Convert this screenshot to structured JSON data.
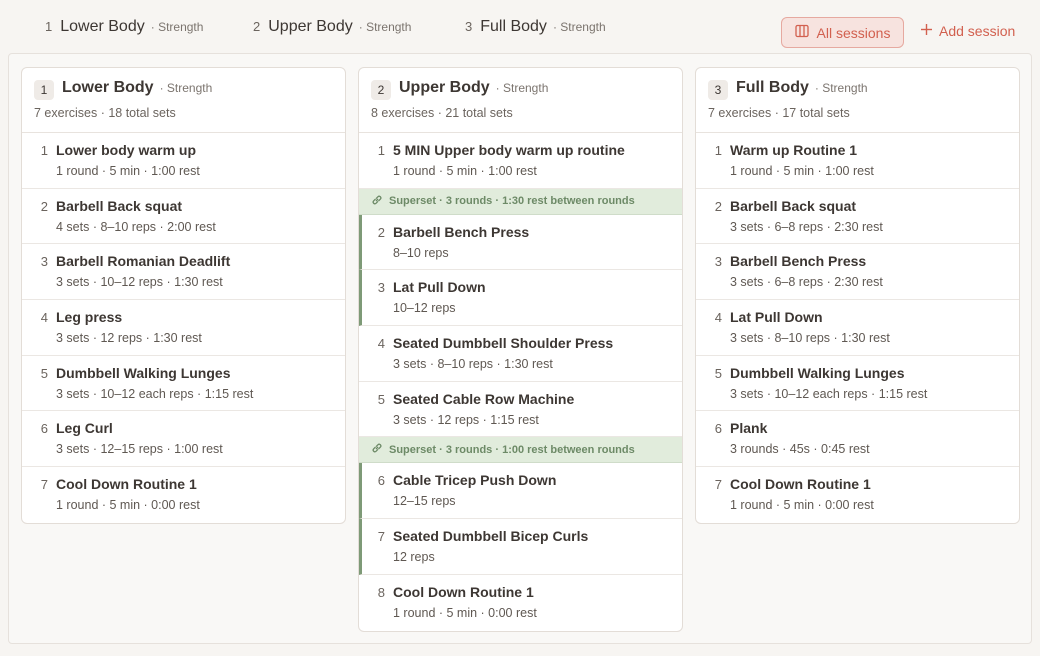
{
  "tabs": [
    {
      "num": "1",
      "name": "Lower Body",
      "type": "· Strength"
    },
    {
      "num": "2",
      "name": "Upper Body",
      "type": "· Strength"
    },
    {
      "num": "3",
      "name": "Full Body",
      "type": "· Strength"
    }
  ],
  "toolbar": {
    "all_sessions_label": "All sessions",
    "add_session_label": "Add session"
  },
  "columns": [
    {
      "num": "1",
      "title": "Lower Body",
      "type": "· Strength",
      "stats": "7 exercises · 18 total sets",
      "exercises": [
        {
          "num": "1",
          "name": "Lower body warm up",
          "detail": "1 round · 5 min · 1:00 rest"
        },
        {
          "num": "2",
          "name": "Barbell Back squat",
          "detail": "4 sets · 8–10 reps · 2:00 rest"
        },
        {
          "num": "3",
          "name": "Barbell Romanian Deadlift",
          "detail": "3 sets · 10–12 reps · 1:30 rest"
        },
        {
          "num": "4",
          "name": "Leg press",
          "detail": "3 sets · 12 reps · 1:30 rest"
        },
        {
          "num": "5",
          "name": "Dumbbell Walking Lunges",
          "detail": "3 sets · 10–12 each reps · 1:15 rest"
        },
        {
          "num": "6",
          "name": "Leg Curl",
          "detail": "3 sets · 12–15 reps · 1:00 rest"
        },
        {
          "num": "7",
          "name": "Cool Down Routine 1",
          "detail": "1 round · 5 min · 0:00 rest"
        }
      ]
    },
    {
      "num": "2",
      "title": "Upper Body",
      "type": "· Strength",
      "stats": "8 exercises · 21 total sets",
      "exercises": [
        {
          "num": "1",
          "name": "5 MIN Upper body warm up routine",
          "detail": "1 round · 5 min · 1:00 rest"
        },
        {
          "num": "2",
          "name": "Barbell Bench Press",
          "detail": "8–10 reps"
        },
        {
          "num": "3",
          "name": "Lat Pull Down",
          "detail": "10–12 reps"
        },
        {
          "num": "4",
          "name": "Seated Dumbbell Shoulder Press",
          "detail": "3 sets · 8–10 reps · 1:30 rest"
        },
        {
          "num": "5",
          "name": "Seated Cable Row Machine",
          "detail": "3 sets · 12 reps · 1:15 rest"
        },
        {
          "num": "6",
          "name": "Cable Tricep Push Down",
          "detail": "12–15 reps"
        },
        {
          "num": "7",
          "name": "Seated Dumbbell Bicep Curls",
          "detail": "12 reps"
        },
        {
          "num": "8",
          "name": "Cool Down Routine 1",
          "detail": "1 round · 5 min · 0:00 rest"
        }
      ],
      "supersets": [
        {
          "label": "Superset · 3 rounds · 1:30 rest between rounds"
        },
        {
          "label": "Superset · 3 rounds · 1:00 rest between rounds"
        }
      ]
    },
    {
      "num": "3",
      "title": "Full Body",
      "type": "· Strength",
      "stats": "7 exercises · 17 total sets",
      "exercises": [
        {
          "num": "1",
          "name": "Warm up Routine 1",
          "detail": "1 round · 5 min · 1:00 rest"
        },
        {
          "num": "2",
          "name": "Barbell Back squat",
          "detail": "3 sets · 6–8 reps · 2:30 rest"
        },
        {
          "num": "3",
          "name": "Barbell Bench Press",
          "detail": "3 sets · 6–8 reps · 2:30 rest"
        },
        {
          "num": "4",
          "name": "Lat Pull Down",
          "detail": "3 sets · 8–10 reps · 1:30 rest"
        },
        {
          "num": "5",
          "name": "Dumbbell Walking Lunges",
          "detail": "3 sets · 10–12 each reps · 1:15 rest"
        },
        {
          "num": "6",
          "name": "Plank",
          "detail": "3 rounds · 45s · 0:45 rest"
        },
        {
          "num": "7",
          "name": "Cool Down Routine 1",
          "detail": "1 round · 5 min · 0:00 rest"
        }
      ]
    }
  ],
  "colors": {
    "accent": "#d2604f",
    "superset_bg": "#e1ecdc",
    "superset_text": "#6d8a67",
    "superset_bar": "#7e9a77"
  },
  "icons": {
    "all_sessions": "columns-icon",
    "add_session": "plus-icon",
    "superset": "link-icon"
  }
}
